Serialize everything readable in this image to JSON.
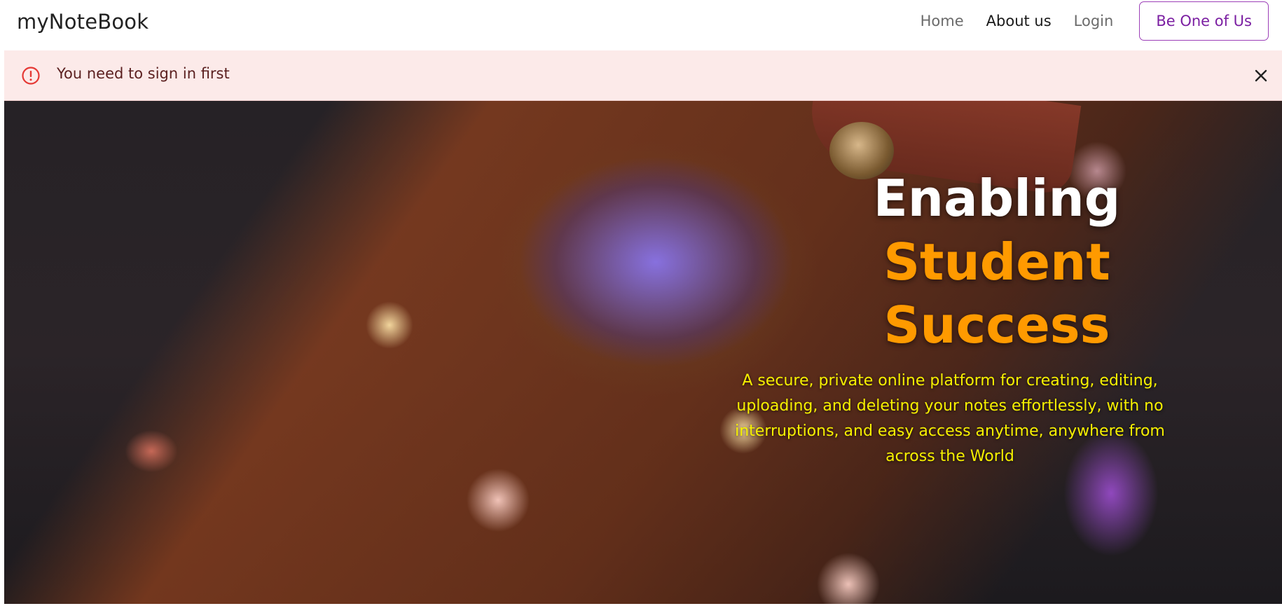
{
  "navbar": {
    "brand": "myNoteBook",
    "links": [
      "Home",
      "About us",
      "Login"
    ],
    "cta_label": "Be One of Us"
  },
  "alert": {
    "message": "You need to sign in first",
    "icon": "exclamation-circle-icon",
    "close_icon": "close-icon"
  },
  "hero": {
    "title_line1": "Enabling",
    "title_line2": "Student",
    "title_line3": "Success",
    "subtitle": "A secure, private online platform for creating, editing, uploading, and deleting your notes effortlessly, with no interruptions, and easy access anytime, anywhere from across the World",
    "accent_color": "#ff9a00",
    "subtitle_color": "#f6f000"
  }
}
